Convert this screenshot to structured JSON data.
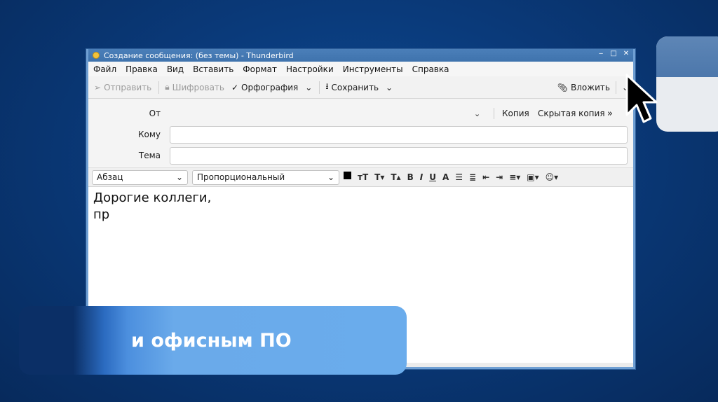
{
  "window": {
    "title": "Создание сообщения: (без темы) - Thunderbird",
    "controls": [
      "‒",
      "□",
      "✕"
    ]
  },
  "menu": [
    "Файл",
    "Правка",
    "Вид",
    "Вставить",
    "Формат",
    "Настройки",
    "Инструменты",
    "Справка"
  ],
  "toolbar": {
    "send": "Отправить",
    "encrypt": "Шифровать",
    "spelling": "Орфография",
    "save": "Сохранить",
    "attach": "Вложить"
  },
  "header": {
    "from_label": "От",
    "cc": "Копия",
    "bcc": "Скрытая копия",
    "more": "»",
    "to_label": "Кому",
    "to_value": "",
    "subject_label": "Тема",
    "subject_value": ""
  },
  "format": {
    "paragraph": "Абзац",
    "font": "Пропорциональный",
    "text_color": "#000000"
  },
  "body": {
    "line1": "Дорогие коллеги,",
    "line2": "пр"
  },
  "banner": {
    "text": "и офисным ПО"
  },
  "colors": {
    "titlebar": "#4479b3",
    "banner": "#6aacec",
    "background": "#0a3a7a"
  }
}
